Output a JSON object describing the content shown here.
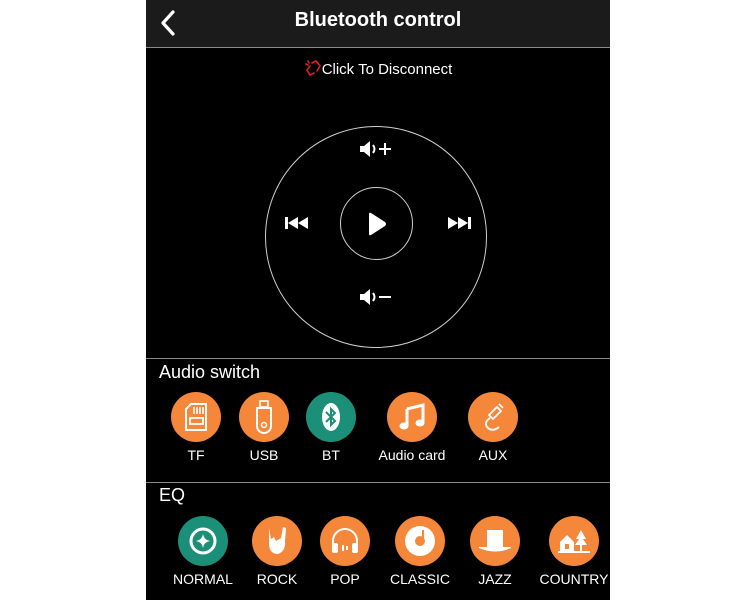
{
  "header": {
    "title": "Bluetooth control",
    "back_icon": "chevron-left-icon"
  },
  "connection": {
    "label": "Click To Disconnect",
    "icon": "broken-link-icon",
    "icon_color": "#e02020"
  },
  "controls": {
    "volume_up": "volume-up-icon",
    "volume_down": "volume-down-icon",
    "previous": "previous-track-icon",
    "next": "next-track-icon",
    "play": "play-icon"
  },
  "audio_switch": {
    "title": "Audio switch",
    "items": [
      {
        "label": "TF",
        "icon": "sd-card-icon",
        "color": "#f5873a",
        "selected": false
      },
      {
        "label": "USB",
        "icon": "usb-drive-icon",
        "color": "#f5873a",
        "selected": false
      },
      {
        "label": "BT",
        "icon": "bluetooth-icon",
        "color": "#1b8f78",
        "selected": true
      },
      {
        "label": "Audio card",
        "icon": "music-note-icon",
        "color": "#f5873a",
        "selected": false
      },
      {
        "label": "AUX",
        "icon": "aux-cable-icon",
        "color": "#f5873a",
        "selected": false
      }
    ]
  },
  "eq": {
    "title": "EQ",
    "items": [
      {
        "label": "NORMAL",
        "icon": "sparkle-icon",
        "color": "#1b8f78",
        "selected": true
      },
      {
        "label": "ROCK",
        "icon": "rock-hand-icon",
        "color": "#f5873a",
        "selected": false
      },
      {
        "label": "POP",
        "icon": "headphones-icon",
        "color": "#f5873a",
        "selected": false
      },
      {
        "label": "CLASSIC",
        "icon": "vinyl-disc-icon",
        "color": "#f5873a",
        "selected": false
      },
      {
        "label": "JAZZ",
        "icon": "top-hat-icon",
        "color": "#f5873a",
        "selected": false
      },
      {
        "label": "COUNTRY",
        "icon": "house-tree-icon",
        "color": "#f5873a",
        "selected": false
      }
    ]
  }
}
